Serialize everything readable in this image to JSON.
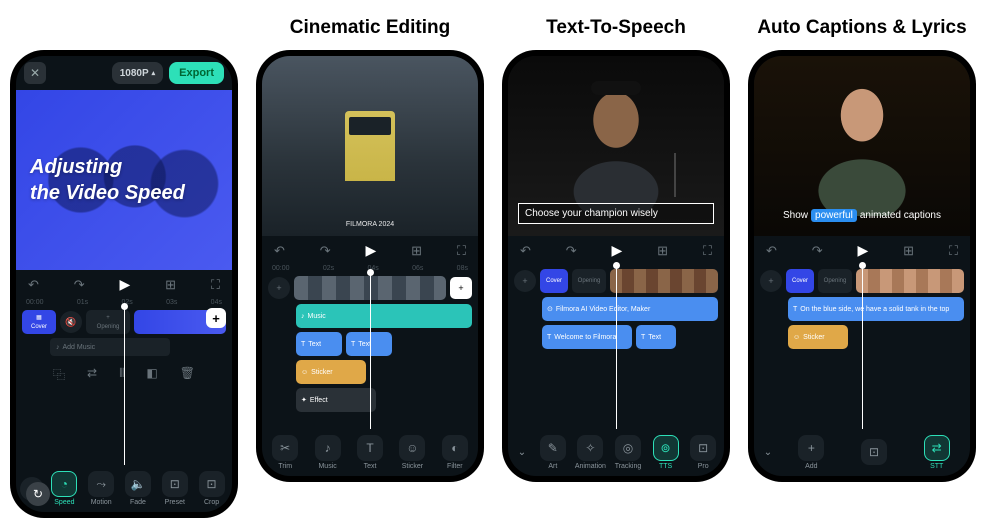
{
  "panels": {
    "p1": {
      "resolution": "1080P",
      "export": "Export",
      "line1": "Adjusting",
      "line2": "the Video Speed",
      "ruler": [
        "00:00",
        "01s",
        "02s",
        "03s",
        "04s"
      ],
      "cover": "Cover",
      "opening": "Opening",
      "addmusic": "Add Music",
      "tools": [
        "Speed",
        "Motion",
        "Fade",
        "Preset",
        "Crop"
      ]
    },
    "p2": {
      "title": "Cinematic Editing",
      "laurel": "FILMORA 2024",
      "ruler": [
        "00:00",
        "02s",
        "04s",
        "06s",
        "08s"
      ],
      "music": "Music",
      "text": "Text",
      "sticker": "Sticker",
      "effect": "Effect",
      "tools": [
        "Trim",
        "Music",
        "Text",
        "Sticker",
        "Filter"
      ]
    },
    "p3": {
      "title": "Text-To-Speech",
      "caption": "Choose your champion wisely",
      "cover": "Cover",
      "opening": "Opening",
      "chip1": "Filmora AI Video Editor, Maker",
      "chip2": "Welcome to Filmora",
      "chip3": "Text",
      "tools": [
        "Art",
        "Animation",
        "Tracking",
        "TTS",
        "Pro"
      ]
    },
    "p4": {
      "title": "Auto Captions & Lyrics",
      "cap_a": "Show",
      "cap_b": "powerful",
      "cap_c": "animated captions",
      "cover": "Cover",
      "opening": "Opening",
      "chip1": "On the blue side, we have a solid tank in the top",
      "sticker": "Sticker",
      "tools": [
        "Add",
        "",
        "STT"
      ]
    }
  }
}
